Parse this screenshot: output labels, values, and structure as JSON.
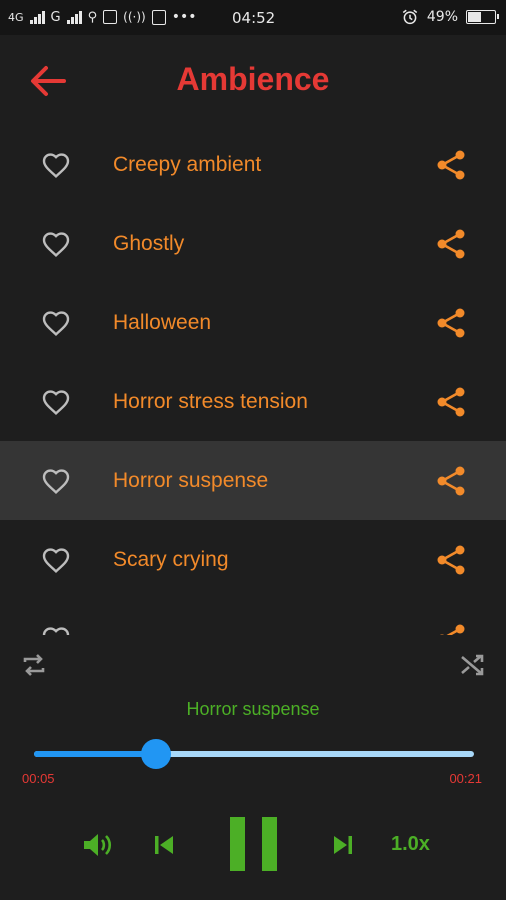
{
  "status": {
    "net1": "4G",
    "net2": "G",
    "time": "04:52",
    "battery": "49%"
  },
  "toolbar": {
    "title": "Ambience"
  },
  "tracks": [
    {
      "name": "Creepy ambient"
    },
    {
      "name": "Ghostly"
    },
    {
      "name": "Halloween"
    },
    {
      "name": "Horror stress tension"
    },
    {
      "name": "Horror suspense"
    },
    {
      "name": "Scary crying"
    }
  ],
  "player": {
    "now_playing": "Horror suspense",
    "current_time": "00:05",
    "total_time": "00:21",
    "progress": 0.278,
    "speed": "1.0x"
  },
  "colors": {
    "accent": "#e53935",
    "track_text": "#f28a2a",
    "player_green": "#4caf26",
    "slider_blue": "#2196f3"
  },
  "icons": [
    "back-arrow-icon",
    "heart-outline-icon",
    "share-icon",
    "repeat-icon",
    "shuffle-icon",
    "volume-icon",
    "skip-previous-icon",
    "pause-icon",
    "skip-next-icon"
  ]
}
